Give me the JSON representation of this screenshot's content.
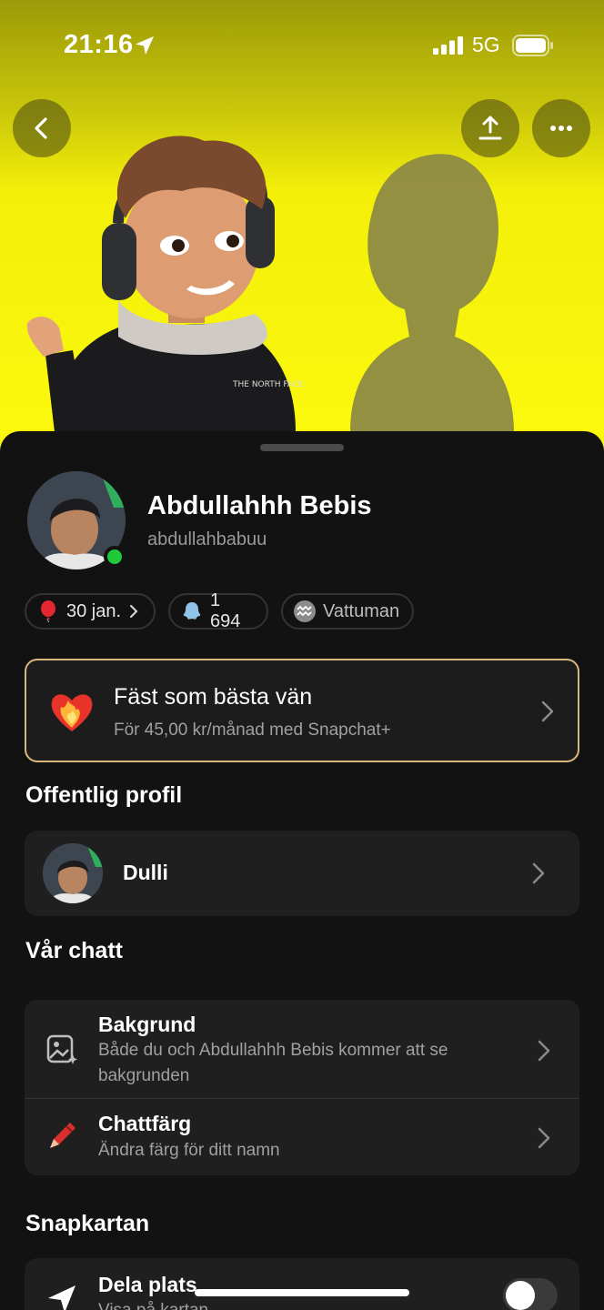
{
  "status_bar": {
    "time": "21:16",
    "network": "5G",
    "icons": [
      "location-arrow-icon",
      "signal-icon",
      "battery-icon"
    ]
  },
  "header": {
    "buttons": [
      "back-icon",
      "share-icon",
      "more-icon"
    ],
    "background_color": "#fcfa0e"
  },
  "profile": {
    "display_name": "Abdullahhh Bebis",
    "username": "abdullahbabuu",
    "online": true,
    "chips": {
      "birthday": "30 jan.",
      "snapscore": "1 694",
      "zodiac": "Vattuman"
    }
  },
  "bff_card": {
    "title": "Fäst som bästa vän",
    "subtitle": "För 45,00 kr/månad med Snapchat+",
    "icon": "heart-fire-icon"
  },
  "public_profile": {
    "section_title": "Offentlig profil",
    "name": "Dulli"
  },
  "our_chat": {
    "section_title": "Vår chatt",
    "rows": [
      {
        "title": "Bakgrund",
        "desc": "Både du och Abdullahhh Bebis kommer att se bakgrunden",
        "icon": "wallpaper-icon"
      },
      {
        "title": "Chattfärg",
        "desc": "Ändra färg för ditt namn",
        "icon": "crayon-icon"
      }
    ]
  },
  "snap_map": {
    "section_title": "Snapkartan",
    "row_title": "Dela plats",
    "row_desc": "Visa på kartan",
    "toggle_on": false
  },
  "colors": {
    "accent": "#fcfa0e",
    "sheet": "#121212",
    "card": "#1f1f1f",
    "bff_border": "#d9b77a",
    "online": "#1fc93a"
  }
}
